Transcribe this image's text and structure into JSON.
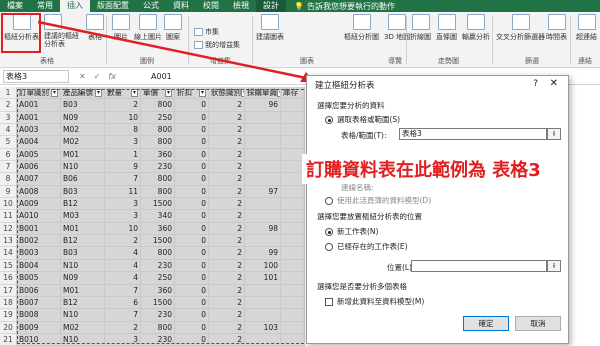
{
  "ribbon_tabs": [
    "檔案",
    "常用",
    "插入",
    "版面配置",
    "公式",
    "資料",
    "校閱",
    "檢視",
    "設計"
  ],
  "tell_me": "告訴我您想要執行的動作",
  "ribbon": {
    "pivot": "樞紐分析表",
    "recommended": "建議的樞紐分析表",
    "table": "表格",
    "picture": "圖片",
    "online_picture": "線上圖片",
    "shapes": "圖案",
    "store": "市集",
    "my_addins": "我的增益集",
    "recommended_charts": "建議圖表",
    "pivot_chart": "樞紐分析圖",
    "map3d": "3D 地圖",
    "line": "折線圖",
    "column": "直條圖",
    "winloss": "輸贏分析",
    "slicer": "交叉分析篩選器",
    "timeline": "時間表",
    "hyperlink": "超連結",
    "groups": [
      "表格",
      "圖例",
      "增益集",
      "圖表",
      "導覽",
      "走勢圖",
      "篩選",
      "連結"
    ]
  },
  "formula_bar": {
    "name_box": "表格3",
    "content": "A001"
  },
  "table": {
    "headers": [
      "訂單識別",
      "產品編號",
      "數量",
      "單價",
      "折扣",
      "狀態識別",
      "採購單識",
      "庫存"
    ],
    "rows": [
      [
        "A001",
        "B03",
        "2",
        "800",
        "0",
        "2",
        "96"
      ],
      [
        "A001",
        "N09",
        "10",
        "250",
        "0",
        "2",
        ""
      ],
      [
        "A003",
        "M02",
        "8",
        "800",
        "0",
        "2",
        ""
      ],
      [
        "A004",
        "M02",
        "3",
        "800",
        "0",
        "2",
        ""
      ],
      [
        "A005",
        "M01",
        "1",
        "360",
        "0",
        "2",
        ""
      ],
      [
        "A006",
        "N10",
        "9",
        "230",
        "0",
        "2",
        ""
      ],
      [
        "A007",
        "B06",
        "7",
        "800",
        "0",
        "2",
        ""
      ],
      [
        "A008",
        "B03",
        "11",
        "800",
        "0",
        "2",
        "97"
      ],
      [
        "A009",
        "B12",
        "3",
        "1500",
        "0",
        "2",
        ""
      ],
      [
        "A010",
        "M03",
        "3",
        "340",
        "0",
        "2",
        ""
      ],
      [
        "B001",
        "M01",
        "10",
        "360",
        "0",
        "2",
        "98"
      ],
      [
        "B002",
        "B12",
        "2",
        "1500",
        "0",
        "2",
        ""
      ],
      [
        "B003",
        "B03",
        "4",
        "800",
        "0",
        "2",
        "99"
      ],
      [
        "B004",
        "N10",
        "4",
        "230",
        "0",
        "2",
        "100"
      ],
      [
        "B005",
        "N09",
        "4",
        "250",
        "0",
        "2",
        "101"
      ],
      [
        "B006",
        "M01",
        "7",
        "360",
        "0",
        "2",
        ""
      ],
      [
        "B007",
        "B12",
        "6",
        "1500",
        "0",
        "2",
        ""
      ],
      [
        "B008",
        "N10",
        "7",
        "230",
        "0",
        "2",
        ""
      ],
      [
        "B009",
        "M02",
        "2",
        "800",
        "0",
        "2",
        "103"
      ],
      [
        "B010",
        "N10",
        "3",
        "230",
        "0",
        "2",
        ""
      ]
    ],
    "row_numbers": [
      "1",
      "2",
      "3",
      "4",
      "5",
      "6",
      "7",
      "8",
      "9",
      "10",
      "11",
      "12",
      "13",
      "14",
      "15",
      "16",
      "17",
      "18",
      "19",
      "20",
      "21"
    ]
  },
  "dialog": {
    "title": "建立樞紐分析表",
    "help": "?",
    "close": "✕",
    "section1": "選擇您要分析的資料",
    "opt_select_range": "選取表格或範圍(S)",
    "range_label": "表格/範圍(T):",
    "range_value": "表格3",
    "conn_name": "連線名稱:",
    "opt_data_model": "使用此活頁簿的資料模型(D)",
    "section2": "選擇您要放置樞紐分析表的位置",
    "opt_new_sheet": "新工作表(N)",
    "opt_existing": "已經存在的工作表(E)",
    "location_label": "位置(L):",
    "location_value": "",
    "section3": "選擇您是否要分析多個表格",
    "add_model": "新增此資料至資料模型(M)",
    "ok": "確定",
    "cancel": "取消"
  },
  "annotation": "訂購資料表在此範例為 表格3",
  "colors": {
    "excel_green": "#217346",
    "highlight_red": "#e02020"
  }
}
